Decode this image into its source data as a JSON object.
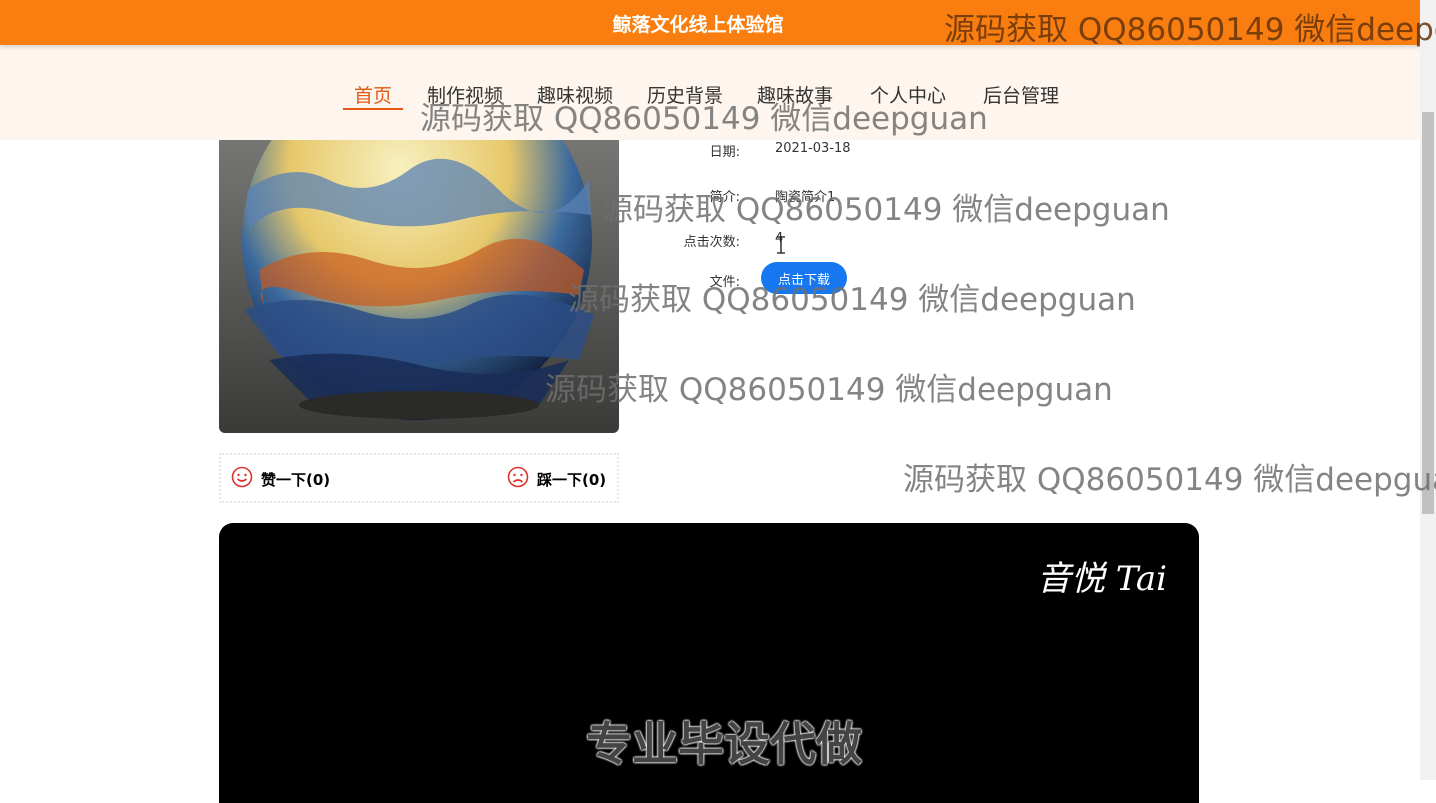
{
  "header": {
    "site_title": "鲸落文化线上体验馆"
  },
  "nav": {
    "items": [
      {
        "label": "首页",
        "active": true
      },
      {
        "label": "制作视频"
      },
      {
        "label": "趣味视频"
      },
      {
        "label": "历史背景"
      },
      {
        "label": "趣味故事"
      },
      {
        "label": "个人中心"
      },
      {
        "label": "后台管理"
      }
    ]
  },
  "detail": {
    "date_label": "日期:",
    "date_value": "2021-03-18",
    "intro_label": "简介:",
    "intro_value": "陶瓷简介1",
    "clicks_label": "点击次数:",
    "clicks_value": "4",
    "file_label": "文件:",
    "download_label": "点击下载"
  },
  "votes": {
    "like_label": "赞一下(0)",
    "dislike_label": "踩一下(0)"
  },
  "video": {
    "logo_text": "音悦 Tai",
    "subtitle": "专业毕设代做"
  },
  "watermark": {
    "text": "源码获取 QQ86050149 微信deepguan"
  },
  "colors": {
    "header": "#f97e0f",
    "nav_bg": "#fdf5ee",
    "active": "#e25a14",
    "button": "#1677f0"
  }
}
